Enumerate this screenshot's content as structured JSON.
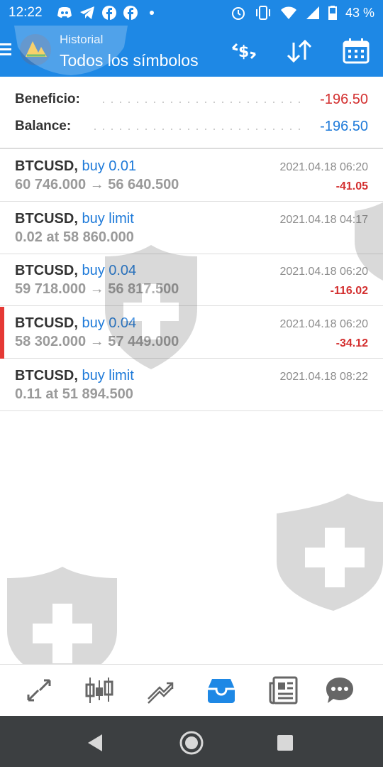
{
  "status_bar": {
    "time": "12:22",
    "battery": "43 %",
    "icons_left": [
      "discord-icon",
      "telegram-icon",
      "facebook-icon",
      "facebook-icon",
      "dot-icon"
    ],
    "icons_right": [
      "alarm-icon",
      "vibrate-icon",
      "wifi-icon",
      "signal-icon",
      "battery-icon"
    ]
  },
  "app_bar": {
    "subtitle": "Historial",
    "title": "Todos los símbolos",
    "actions": [
      "currency-exchange-icon",
      "sort-icon",
      "calendar-icon"
    ]
  },
  "summary": {
    "profit_label": "Beneficio:",
    "profit_value": "-196.50",
    "balance_label": "Balance:",
    "balance_value": "-196.50"
  },
  "trades": [
    {
      "symbol": "BTCUSD,",
      "type": "buy 0.01",
      "prices": "60 746.000 → 56 640.500",
      "datetime": "2021.04.18 06:20",
      "pl": "-41.05"
    },
    {
      "symbol": "BTCUSD,",
      "type": "buy limit",
      "prices": "0.02 at 58 860.000",
      "datetime": "2021.04.18 04:17",
      "pl": ""
    },
    {
      "symbol": "BTCUSD,",
      "type": "buy 0.04",
      "prices": "59 718.000 → 56 817.500",
      "datetime": "2021.04.18 06:20",
      "pl": "-116.02"
    },
    {
      "symbol": "BTCUSD,",
      "type": "buy 0.04",
      "prices": "58 302.000 → 57 449.000",
      "datetime": "2021.04.18 06:20",
      "pl": "-34.12"
    },
    {
      "symbol": "BTCUSD,",
      "type": "buy limit",
      "prices": "0.11 at 51 894.500",
      "datetime": "2021.04.18 08:22",
      "pl": ""
    }
  ],
  "tabs": [
    "quotes-icon",
    "chart-icon",
    "trade-icon",
    "history-icon",
    "news-icon",
    "chat-icon"
  ],
  "active_tab": "history-icon",
  "colors": {
    "primary": "#1e88e5",
    "negative": "#d32f2f",
    "link": "#1e7ad9",
    "nav_bar": "#3c3f41"
  }
}
